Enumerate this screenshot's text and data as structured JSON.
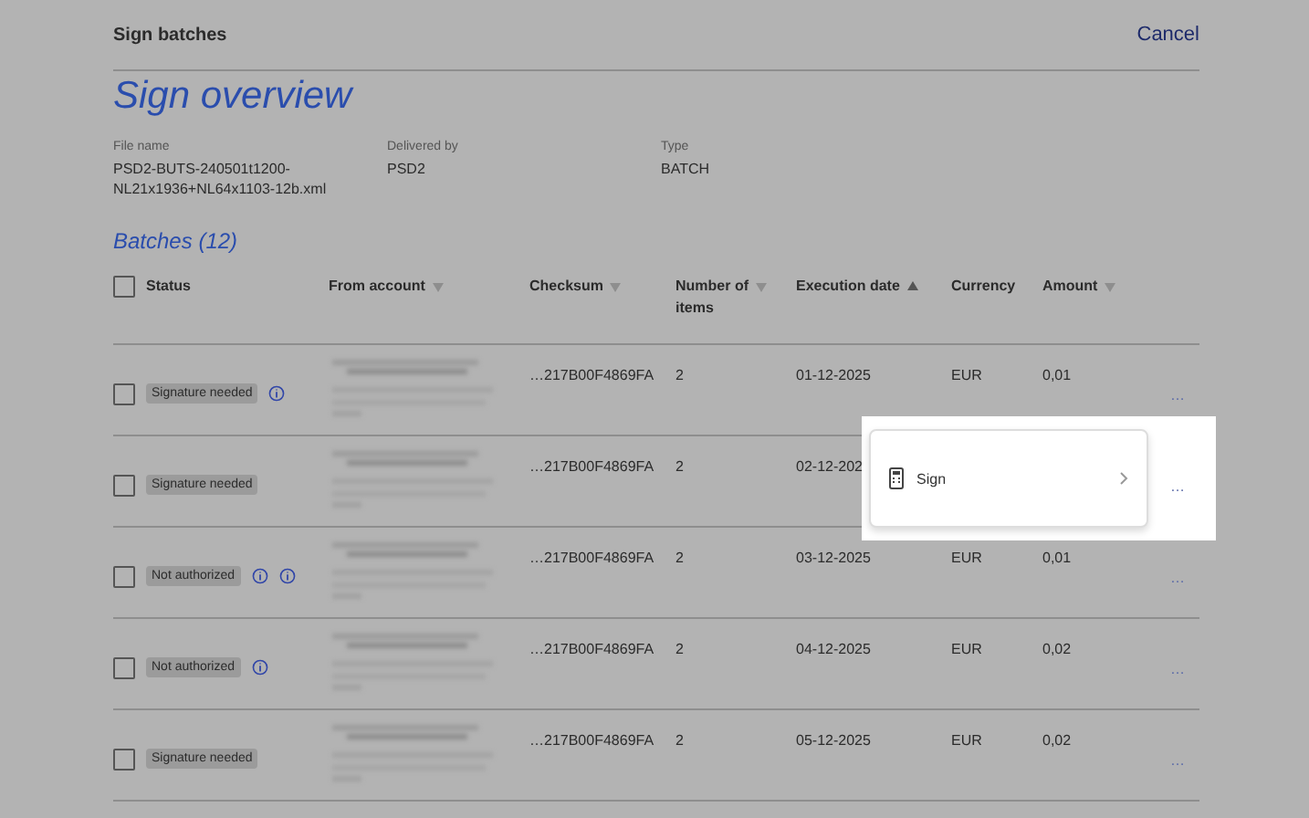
{
  "dialog": {
    "title": "Sign batches",
    "cancel": "Cancel"
  },
  "heading": "Sign overview",
  "meta": [
    {
      "label": "File name",
      "value": "PSD2-BUTS-240501t1200-\nNL21x1936+NL64x1103-12b.xml"
    },
    {
      "label": "Delivered by",
      "value": "PSD2"
    },
    {
      "label": "Type",
      "value": "BATCH"
    }
  ],
  "batches_title": "Batches (12)",
  "table": {
    "select_all": {
      "checked": false
    },
    "columns": [
      {
        "label": "Status"
      },
      {
        "label": "From account",
        "sorted": false
      },
      {
        "label": "Checksum",
        "sorted": false
      },
      {
        "label": "Number of\nitems",
        "sorted": false
      },
      {
        "label": "Execution date",
        "sorted": true
      },
      {
        "label": "Currency"
      },
      {
        "label": "Amount",
        "sorted": false
      }
    ],
    "rows": [
      {
        "checked": false,
        "status": "Signature needed",
        "info_icons": [
          {
            "kind": "info"
          }
        ],
        "checksum": "…217B00F4869FA",
        "items": "2",
        "date": "01-12-2025",
        "currency": "EUR",
        "amount": "0,01",
        "menu": "…"
      },
      {
        "checked": false,
        "status": "Signature needed",
        "info_icons": [],
        "checksum": "…217B00F4869FA",
        "items": "2",
        "date": "02-12-202",
        "menu": "…"
      },
      {
        "checked": false,
        "status": "Not authorized",
        "info_icons": [
          {
            "kind": "info"
          },
          {
            "kind": "info"
          }
        ],
        "checksum": "…217B00F4869FA",
        "items": "2",
        "date": "03-12-2025",
        "currency": "EUR",
        "amount": "0,01",
        "menu": "…"
      },
      {
        "checked": false,
        "status": "Not authorized",
        "info_icons": [
          {
            "kind": "info"
          }
        ],
        "checksum": "…217B00F4869FA",
        "items": "2",
        "date": "04-12-2025",
        "currency": "EUR",
        "amount": "0,02",
        "menu": "…"
      },
      {
        "checked": false,
        "status": "Signature needed",
        "info_icons": [],
        "checksum": "…217B00F4869FA",
        "items": "2",
        "date": "05-12-2025",
        "currency": "EUR",
        "amount": "0,02",
        "menu": "…"
      }
    ]
  },
  "popup": {
    "items": [
      {
        "label": "Sign"
      }
    ]
  }
}
